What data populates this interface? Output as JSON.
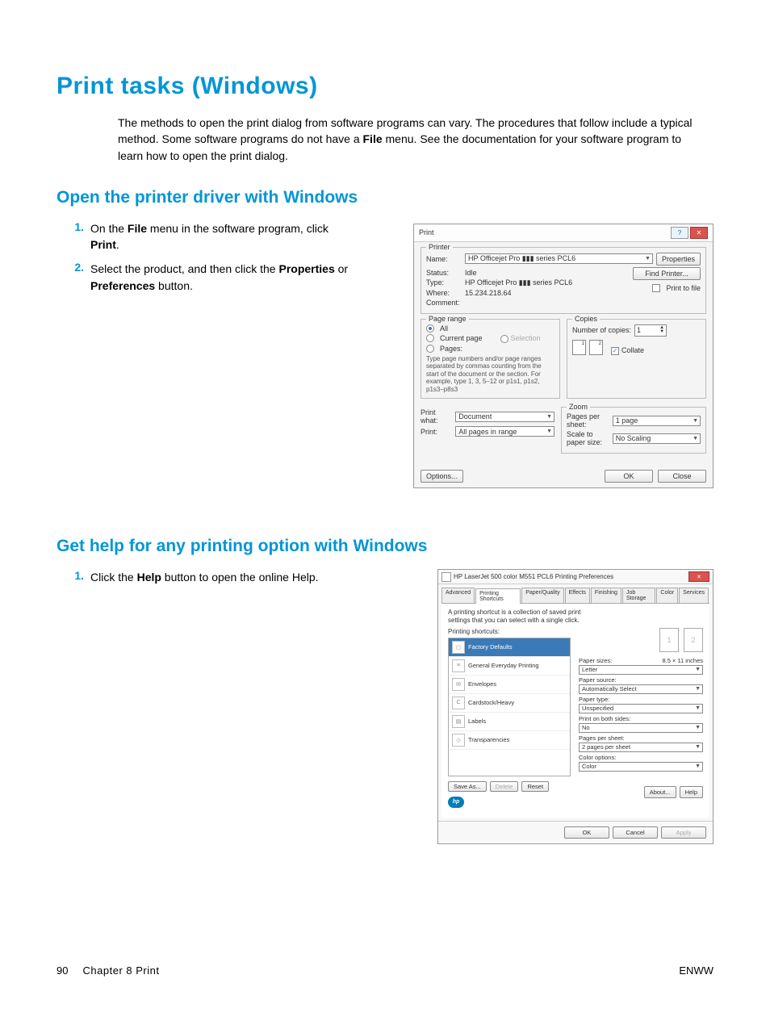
{
  "title": "Print tasks (Windows)",
  "intro_parts": {
    "a": "The methods to open the print dialog from software programs can vary. The procedures that follow include a typical method. Some software programs do not have a ",
    "b": "File",
    "c": " menu. See the documentation for your software program to learn how to open the print dialog."
  },
  "section1": {
    "heading": "Open the printer driver with Windows",
    "steps": [
      {
        "num": "1.",
        "parts": [
          "On the ",
          "File",
          " menu in the software program, click ",
          "Print",
          "."
        ]
      },
      {
        "num": "2.",
        "parts": [
          "Select the product, and then click the ",
          "Properties",
          " or ",
          "Preferences",
          " button."
        ]
      }
    ]
  },
  "section2": {
    "heading": "Get help for any printing option with Windows",
    "steps": [
      {
        "num": "1.",
        "parts": [
          "Click the ",
          "Help",
          " button to open the online Help."
        ]
      }
    ]
  },
  "print_dialog": {
    "title": "Print",
    "printer": {
      "group": "Printer",
      "name_lbl": "Name:",
      "name_val": "HP Officejet Pro ▮▮▮ series PCL6",
      "status_lbl": "Status:",
      "status_val": "Idle",
      "type_lbl": "Type:",
      "type_val": "HP Officejet Pro ▮▮▮ series PCL6",
      "where_lbl": "Where:",
      "where_val": "15.234.218.64",
      "comment_lbl": "Comment:",
      "properties_btn": "Properties",
      "find_printer_btn": "Find Printer...",
      "print_to_file": "Print to file"
    },
    "page_range": {
      "group": "Page range",
      "all": "All",
      "current": "Current page",
      "selection": "Selection",
      "pages": "Pages:",
      "hint": "Type page numbers and/or page ranges separated by commas counting from the start of the document or the section. For example, type 1, 3, 5–12 or p1s1, p1s2, p1s3–p8s3"
    },
    "copies": {
      "group": "Copies",
      "num_lbl": "Number of copies:",
      "num_val": "1",
      "collate": "Collate"
    },
    "zoom": {
      "group": "Zoom",
      "pps_lbl": "Pages per sheet:",
      "pps_val": "1 page",
      "scale_lbl": "Scale to paper size:",
      "scale_val": "No Scaling"
    },
    "print_what_lbl": "Print what:",
    "print_what_val": "Document",
    "print_lbl": "Print:",
    "print_val": "All pages in range",
    "options_btn": "Options...",
    "ok_btn": "OK",
    "close_btn": "Close"
  },
  "prefs_dialog": {
    "title": "HP LaserJet 500 color M551 PCL6 Printing Preferences",
    "tabs": [
      "Advanced",
      "Printing Shortcuts",
      "Paper/Quality",
      "Effects",
      "Finishing",
      "Job Storage",
      "Color",
      "Services"
    ],
    "active_tab": 1,
    "desc": "A printing shortcut is a collection of saved print settings that you can select with a single click.",
    "shortcuts_lbl": "Printing shortcuts:",
    "shortcuts": [
      "Factory Defaults",
      "General Everyday Printing",
      "Envelopes",
      "Cardstock/Heavy",
      "Labels",
      "Transparencies"
    ],
    "opts": {
      "paper_sizes_lbl": "Paper sizes:",
      "paper_sizes_hint": "8.5 × 11 inches",
      "paper_sizes_val": "Letter",
      "paper_source_lbl": "Paper source:",
      "paper_source_val": "Automatically Select",
      "paper_type_lbl": "Paper type:",
      "paper_type_val": "Unspecified",
      "both_sides_lbl": "Print on both sides:",
      "both_sides_val": "No",
      "pps_lbl": "Pages per sheet:",
      "pps_val": "2 pages per sheet",
      "color_lbl": "Color options:",
      "color_val": "Color"
    },
    "saveas_btn": "Save As...",
    "delete_btn": "Delete",
    "reset_btn": "Reset",
    "about_btn": "About...",
    "help_btn": "Help",
    "ok_btn": "OK",
    "cancel_btn": "Cancel",
    "apply_btn": "Apply"
  },
  "footer": {
    "page_num": "90",
    "chapter": "Chapter 8   Print",
    "right": "ENWW"
  }
}
